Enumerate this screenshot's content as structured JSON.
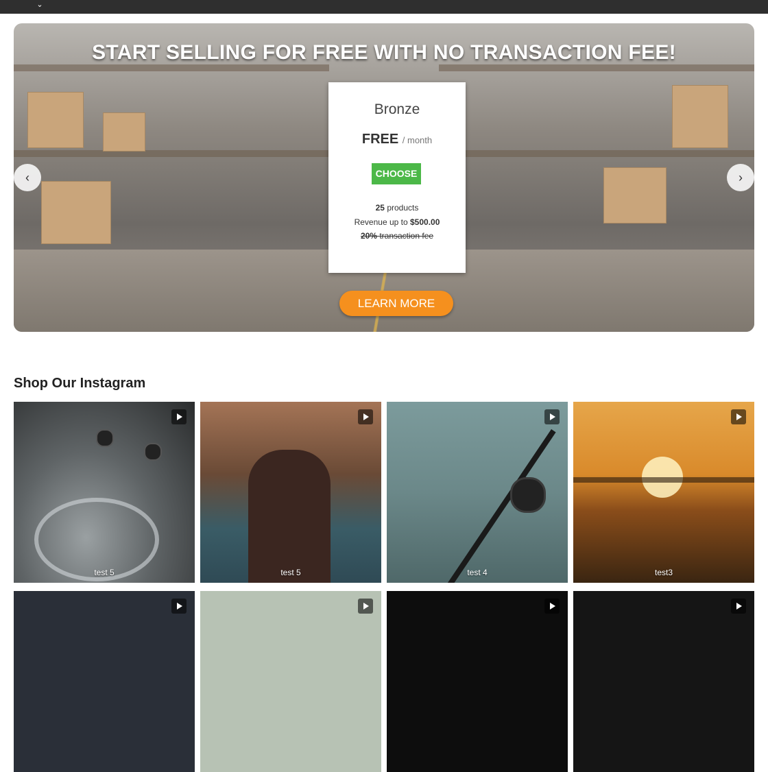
{
  "topbar": {
    "chevron_icon": "chevron-down-icon"
  },
  "hero": {
    "headline": "START SELLING FOR FREE WITH NO TRANSACTION FEE!",
    "plan": {
      "name": "Bronze",
      "price": "FREE",
      "period": "/ month",
      "choose_label": "CHOOSE",
      "products_count": "25",
      "products_label": "products",
      "revenue_prefix": "Revenue up to",
      "revenue_value": "$500.00",
      "fee_value": "20%",
      "fee_label": "transaction fee"
    },
    "learn_more_label": "LEARN MORE",
    "prev_icon": "chevron-left-icon",
    "next_icon": "chevron-right-icon"
  },
  "instagram": {
    "title": "Shop Our Instagram",
    "items": [
      {
        "caption": "test 5",
        "icon": "play-icon"
      },
      {
        "caption": "test 5",
        "icon": "play-icon"
      },
      {
        "caption": "test 4",
        "icon": "play-icon"
      },
      {
        "caption": "test3",
        "icon": "play-icon"
      },
      {
        "caption": "",
        "icon": "play-icon"
      },
      {
        "caption": "",
        "icon": "play-icon"
      },
      {
        "caption": "",
        "icon": "play-icon"
      },
      {
        "caption": "",
        "icon": "play-icon"
      }
    ]
  },
  "colors": {
    "choose": "#4cb848",
    "learn_more": "#f5901e",
    "topbar": "#2f2f2f"
  }
}
